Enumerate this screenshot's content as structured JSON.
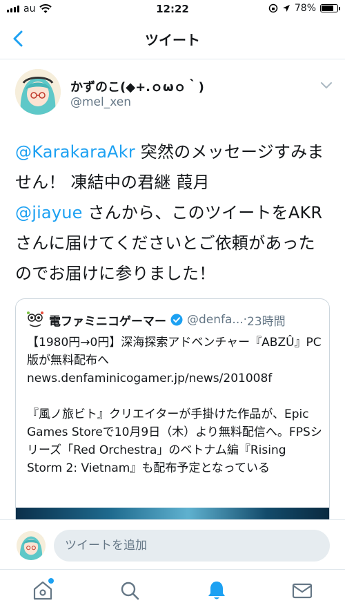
{
  "status_bar": {
    "carrier": "au",
    "time": "12:22",
    "battery": "78%",
    "battery_level": 0.78
  },
  "nav": {
    "title": "ツイート"
  },
  "tweet": {
    "display_name": "かずのこ(◆+.ｏωｏ｀)",
    "handle": "@mel_xen",
    "text_mention_1": "@KarakaraAkr",
    "text_part_1": " 突然のメッセージすみません！ 凍結中の君継 葭月",
    "text_mention_2": "@jiayue",
    "text_part_2": " さんから、このツイートをAKRさんに届けてくださいとご依頼があったのでお届けに参りました！"
  },
  "quote": {
    "name": "電ファミニコゲーマー",
    "handle": "@denfa...",
    "separator": " · ",
    "time": "23時間",
    "line_1": "【1980円→0円】深海探索アドベンチャー『ABZÛ』PC版が無料配布へ",
    "line_2": "news.denfaminicogamer.jp/news/201008f",
    "line_3": "『風ノ旅ビト』クリエイターが手掛けた作品が、Epic Games Storeで10月9日（木）より無料配信へ。FPSシリーズ「Red Orchestra」のベトナム編『Rising Storm 2: Vietnam』も配布予定となっている"
  },
  "reply": {
    "placeholder": "ツイートを追加"
  },
  "tabs": {
    "home_icon": "home-icon",
    "search_icon": "search-icon",
    "notifications_icon": "bell-icon",
    "messages_icon": "mail-icon"
  },
  "colors": {
    "accent": "#1da1f2",
    "text": "#14171a",
    "muted": "#657786"
  }
}
